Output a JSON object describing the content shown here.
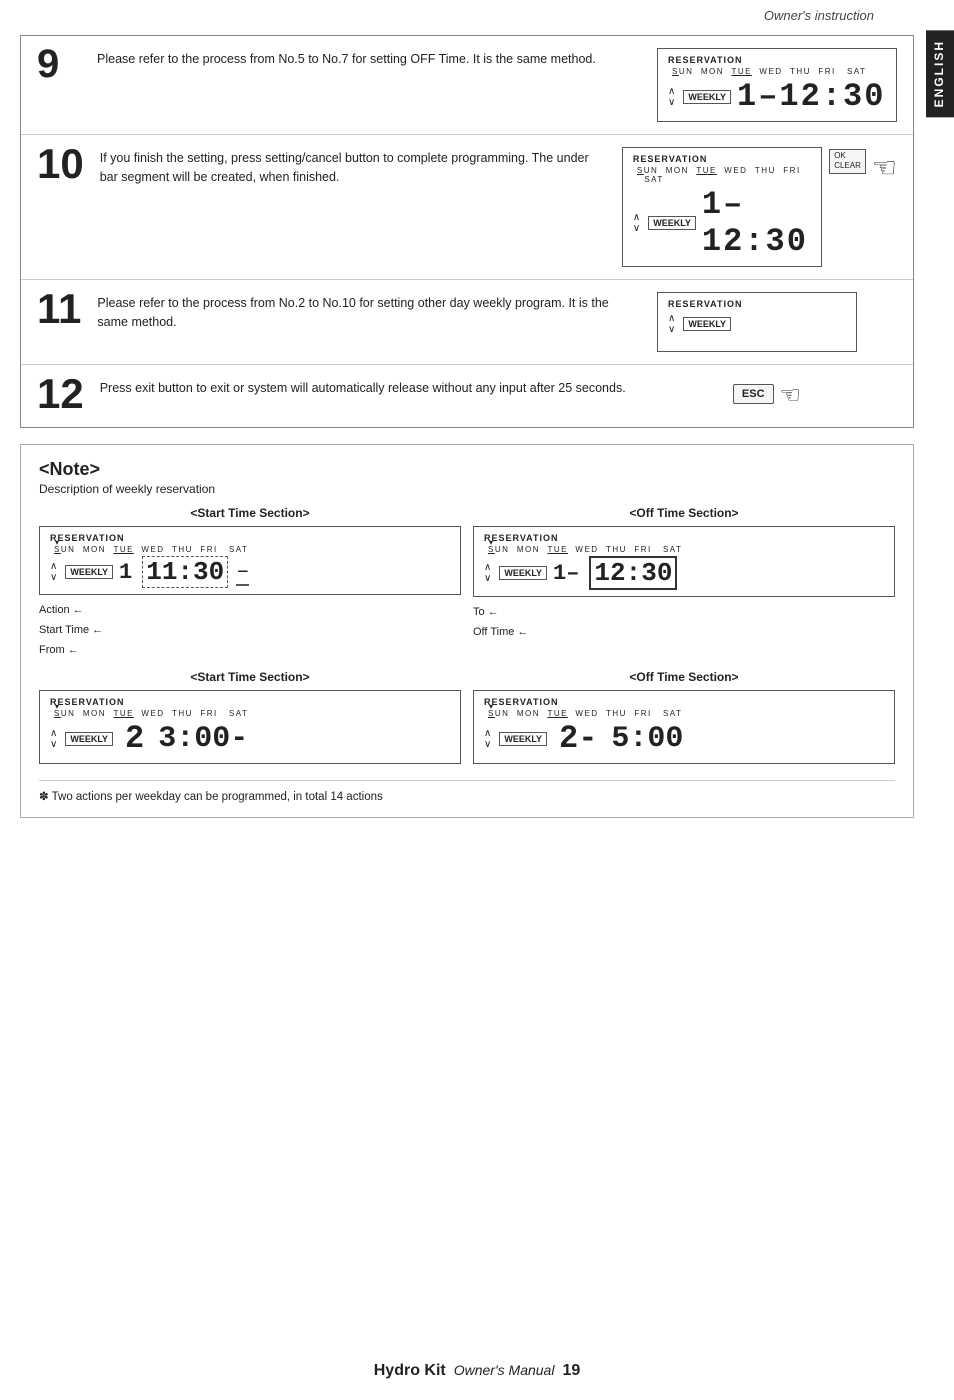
{
  "header": {
    "title": "Owner's instruction",
    "english_tab": "ENGLISH"
  },
  "steps": [
    {
      "number": "9",
      "text": "Please refer to the process from No.5 to No.7 for setting OFF Time. It is the same method.",
      "display": {
        "label": "RESERVATION",
        "days": "SUN MON TUE WED THU FRI SAT",
        "weekly": "WEEKLY",
        "time": "1- 12:30"
      }
    },
    {
      "number": "10",
      "text": "If you finish the setting, press setting/cancel button to complete programming. The under bar segment will be created, when finished.",
      "display": {
        "label": "RESERVATION",
        "days": "SUN MON TUE WED THU FRI SAT",
        "weekly": "WEEKLY",
        "time": "1- 12:30",
        "ok_clear": "OK\nCLEAR"
      },
      "has_hand": true
    },
    {
      "number": "11",
      "text": "Please refer to the process from No.2 to No.10 for setting other day weekly program. It is the same method.",
      "display": {
        "label": "RESERVATION",
        "weekly": "WEEKLY"
      }
    },
    {
      "number": "12",
      "text": "Press exit button to exit or system will automatically release without any input after 25 seconds.",
      "has_esc": true
    }
  ],
  "note": {
    "title": "<Note>",
    "subtitle": "Description of  weekly reservation",
    "start_time_label": "<Start Time Section>",
    "off_time_label": "<Off Time Section>",
    "start_display_1": {
      "label": "RESERVATION",
      "days": "SUN MON TUE WED THU FRI SAT",
      "weekly": "WEEKLY",
      "time_prefix": "1",
      "time": "11:30"
    },
    "off_display_1": {
      "label": "RESERVATION",
      "days": "SUN MON TUE WED THU FRI SAT",
      "weekly": "WEEKLY",
      "time_prefix": "1-",
      "time": "12:30"
    },
    "annotations_left": {
      "action": "Action ←",
      "start_time": "Start Time ←",
      "from": "From ←"
    },
    "annotations_right": {
      "to": "To ←",
      "off_time": "Off Time ←"
    },
    "start_time_label_2": "<Start Time Section>",
    "off_time_label_2": "<Off Time Section>",
    "start_display_2": {
      "label": "RESERVATION",
      "days": "SUN MON TUE WED THU FRI SAT",
      "weekly": "WEEKLY",
      "number": "2",
      "time": "3:00-"
    },
    "off_display_2": {
      "label": "RESERVATION",
      "days": "SUN MON TUE WED THU FRI SAT",
      "weekly": "WEEKLY",
      "number": "2-",
      "time": "5:00"
    },
    "footer": "✽ Two actions per weekday can be programmed, in total 14 actions"
  },
  "footer": {
    "brand": "Hydro Kit",
    "manual": "Owner's Manual",
    "page": "19"
  }
}
